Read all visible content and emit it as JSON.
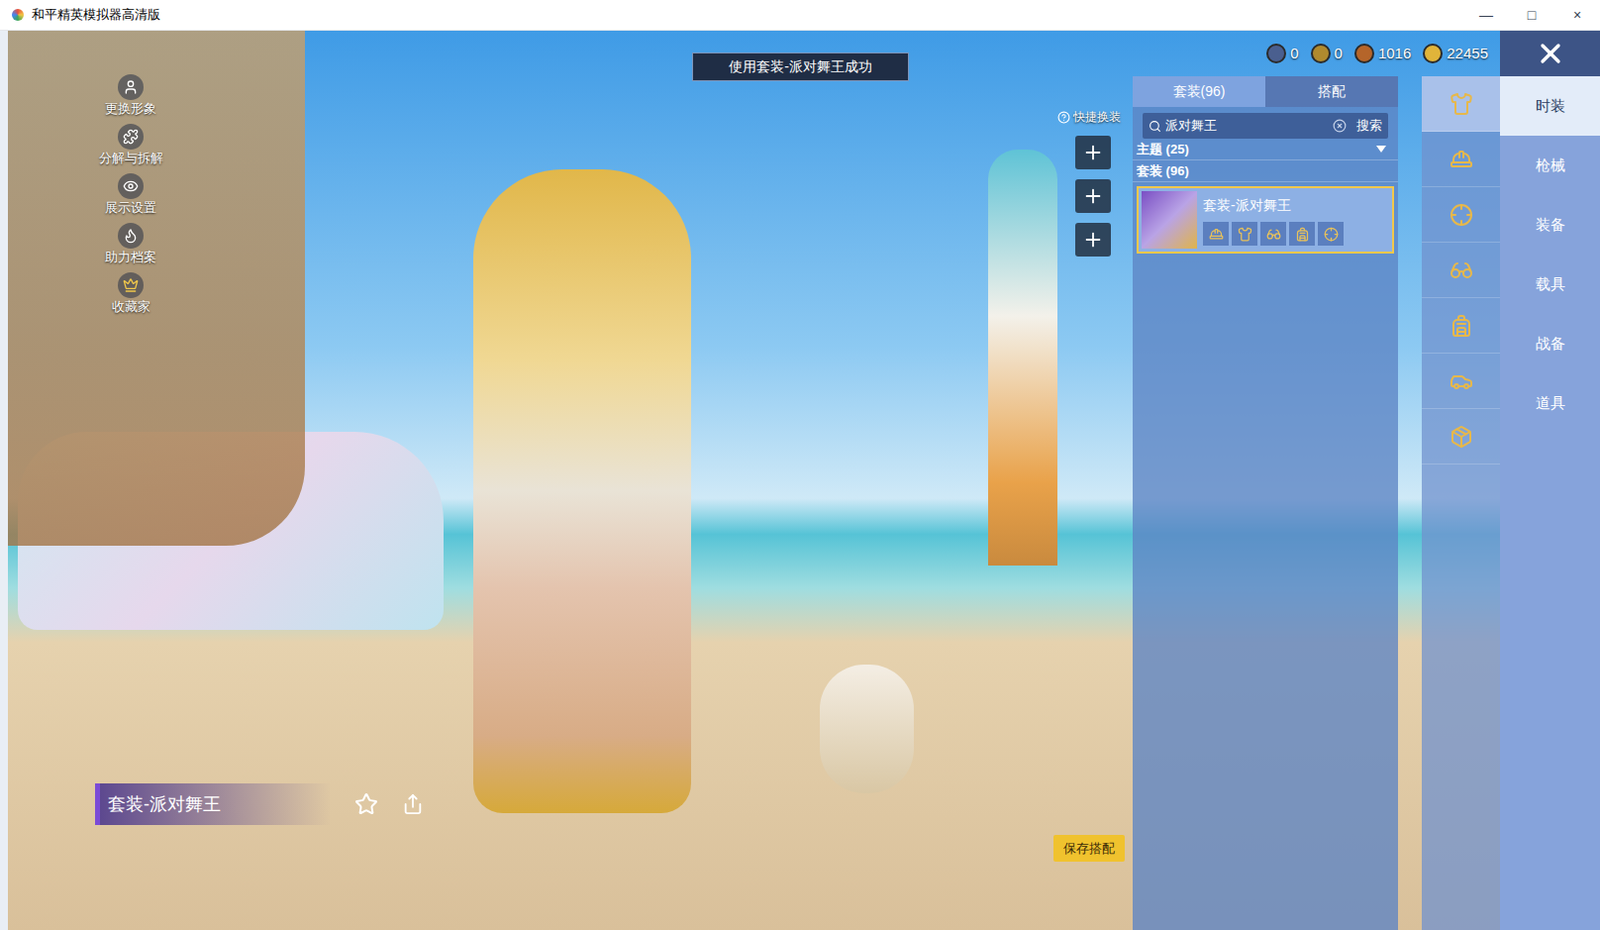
{
  "window": {
    "title": "和平精英模拟器高清版",
    "controls": [
      "—",
      "□",
      "×"
    ]
  },
  "left_menu": [
    {
      "label": "更换形象"
    },
    {
      "label": "分解与拆解"
    },
    {
      "label": "展示设置"
    },
    {
      "label": "助力档案"
    },
    {
      "label": "收藏家"
    }
  ],
  "toast": "使用套装-派对舞王成功",
  "currencies": [
    {
      "value": "0",
      "color": "#4a5f8f"
    },
    {
      "value": "0",
      "color": "#b08a2e"
    },
    {
      "value": "1016",
      "color": "#b5652a"
    },
    {
      "value": "22455",
      "color": "#e0b43a"
    }
  ],
  "quick_change": {
    "label": "快捷换装",
    "slots": 3
  },
  "panel": {
    "tabs": [
      {
        "label": "套装(96)",
        "selected": true
      },
      {
        "label": "搭配",
        "selected": false
      }
    ],
    "search": {
      "value": "派对舞王",
      "button": "搜索"
    },
    "sections": [
      {
        "label": "主题 (25)",
        "expanded": false
      },
      {
        "label": "套装 (96)",
        "expanded": true
      }
    ],
    "cards": [
      {
        "title": "套装-派对舞王",
        "selected": true,
        "parts": 5
      }
    ]
  },
  "icon_column": [
    {
      "selected": true
    },
    {
      "selected": false
    },
    {
      "selected": false
    },
    {
      "selected": false
    },
    {
      "selected": false
    },
    {
      "selected": false
    },
    {
      "selected": false
    }
  ],
  "categories": [
    {
      "label": "时装",
      "selected": true
    },
    {
      "label": "枪械",
      "selected": false
    },
    {
      "label": "装备",
      "selected": false
    },
    {
      "label": "载具",
      "selected": false
    },
    {
      "label": "战备",
      "selected": false
    },
    {
      "label": "道具",
      "selected": false
    }
  ],
  "outfit_label": "套装-派对舞王",
  "save_button": "保存搭配"
}
